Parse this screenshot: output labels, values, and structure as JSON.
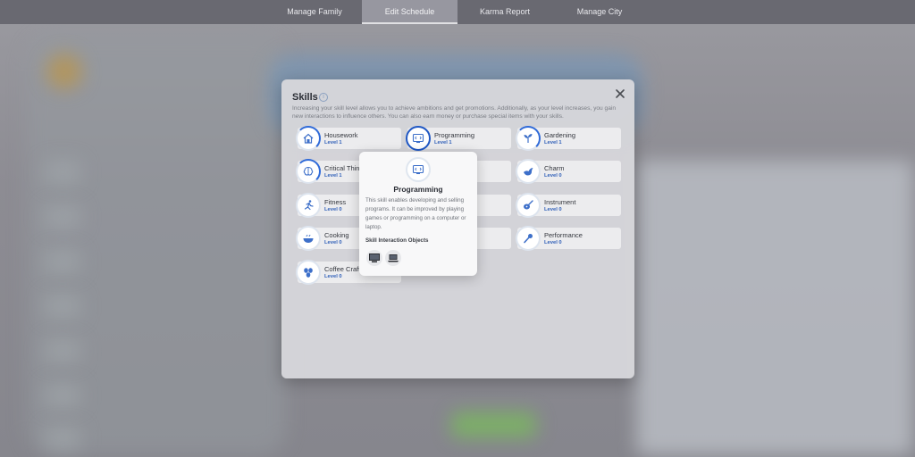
{
  "nav": {
    "tabs": [
      {
        "label": "Manage Family",
        "active": false
      },
      {
        "label": "Edit Schedule",
        "active": true
      },
      {
        "label": "Karma Report",
        "active": false
      },
      {
        "label": "Manage City",
        "active": false
      }
    ]
  },
  "skills_panel": {
    "title": "Skills",
    "description": "Increasing your skill level allows you to achieve ambitions and get promotions. Additionally, as your level increases, you gain new interactions to influence others. You can also earn money or purchase special items with your skills.",
    "accent_color": "#2f6ad8",
    "skills": [
      {
        "name": "Housework",
        "level": "Level 1",
        "icon": "house-icon"
      },
      {
        "name": "Programming",
        "level": "Level 1",
        "icon": "monitor-code-icon"
      },
      {
        "name": "Gardening",
        "level": "Level 1",
        "icon": "sprout-icon"
      },
      {
        "name": "Critical Thinking",
        "level": "Level 1",
        "icon": "brain-icon"
      },
      {
        "name": "Charm",
        "level": "Level 0",
        "icon": "bird-icon"
      },
      {
        "name": "Fitness",
        "level": "Level 0",
        "icon": "running-icon"
      },
      {
        "name": "Instrument",
        "level": "Level 0",
        "icon": "guitar-icon"
      },
      {
        "name": "Cooking",
        "level": "Level 0",
        "icon": "bowl-icon"
      },
      {
        "name": "Performance",
        "level": "Level 0",
        "icon": "microphone-icon"
      },
      {
        "name": "Coffee Craft",
        "level": "Level 0",
        "icon": "coffee-bean-icon"
      }
    ]
  },
  "tooltip": {
    "title": "Programming",
    "description": "This skill enables developing and selling programs. It can be improved by playing games or programming on a computer or laptop.",
    "objects_heading": "Skill Interaction Objects",
    "objects": [
      {
        "icon": "desktop-computer-icon"
      },
      {
        "icon": "laptop-icon"
      }
    ]
  }
}
